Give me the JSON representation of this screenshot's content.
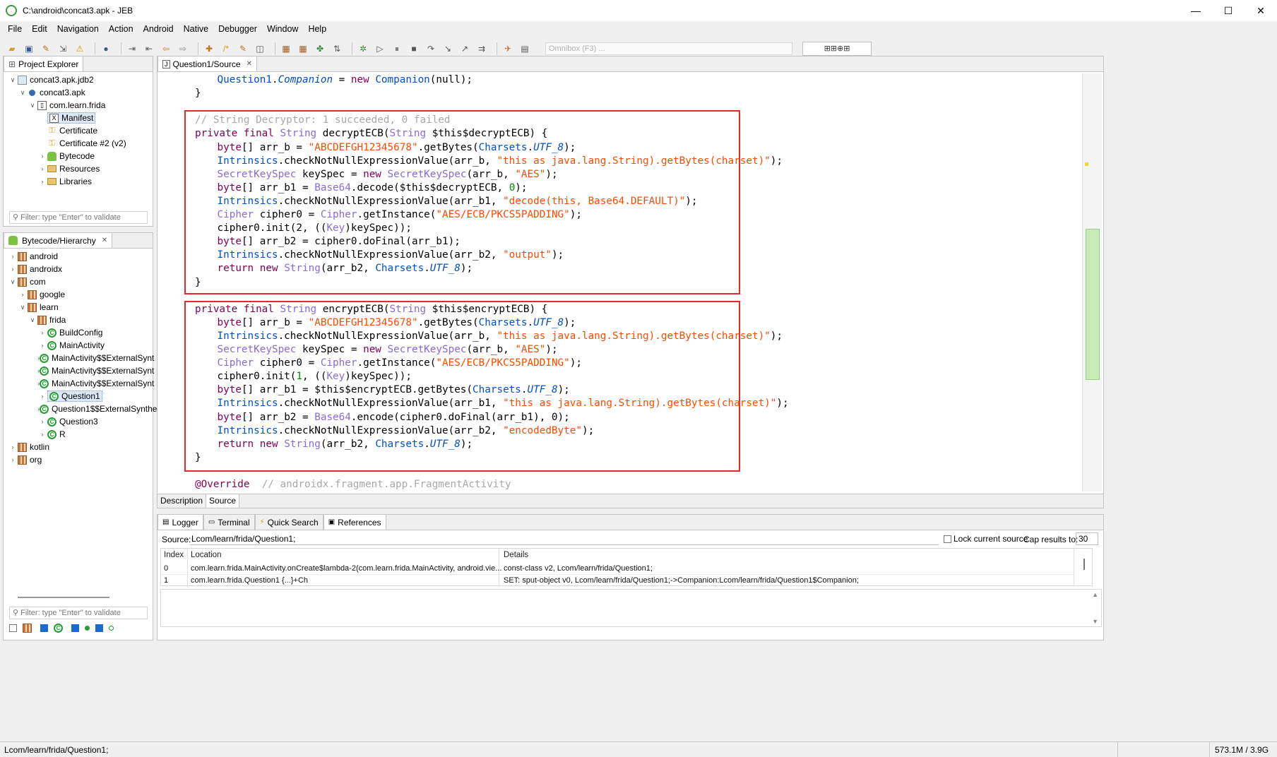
{
  "window": {
    "title": "C:\\android\\concat3.apk - JEB",
    "controls": {
      "minimize": "—",
      "maximize": "☐",
      "close": "✕"
    }
  },
  "menu": [
    "File",
    "Edit",
    "Navigation",
    "Action",
    "Android",
    "Native",
    "Debugger",
    "Window",
    "Help"
  ],
  "toolbar": {
    "omnibox_placeholder": "Omnibox (F3) ...",
    "extra_button": "⊞⊞⊕⊞"
  },
  "project_explorer": {
    "tab_label": "Project Explorer",
    "filter_placeholder": "Filter: type \"Enter\" to validate",
    "items": [
      {
        "label": "concat3.apk.jdb2",
        "level": 0,
        "expanded": true,
        "icon": "jdb-icon"
      },
      {
        "label": "concat3.apk",
        "level": 1,
        "expanded": true,
        "icon": "apk-icon"
      },
      {
        "label": "com.learn.frida",
        "level": 2,
        "expanded": true,
        "icon": "package-icon"
      },
      {
        "label": "Manifest",
        "level": 3,
        "icon": "manifest-icon",
        "selected": true
      },
      {
        "label": "Certificate",
        "level": 3,
        "icon": "key-icon"
      },
      {
        "label": "Certificate #2 (v2)",
        "level": 3,
        "icon": "key-icon"
      },
      {
        "label": "Bytecode",
        "level": 3,
        "expandable": true,
        "icon": "android-icon"
      },
      {
        "label": "Resources",
        "level": 3,
        "expandable": true,
        "icon": "folder-icon"
      },
      {
        "label": "Libraries",
        "level": 3,
        "expandable": true,
        "icon": "folder-icon"
      }
    ]
  },
  "hierarchy": {
    "tab_label": "Bytecode/Hierarchy",
    "filter_placeholder": "Filter: type \"Enter\" to validate",
    "items": [
      {
        "label": "android",
        "level": 0,
        "expandable": true,
        "icon": "pkg"
      },
      {
        "label": "androidx",
        "level": 0,
        "expandable": true,
        "icon": "pkg"
      },
      {
        "label": "com",
        "level": 0,
        "expanded": true,
        "icon": "pkg"
      },
      {
        "label": "google",
        "level": 1,
        "expandable": true,
        "icon": "pkg"
      },
      {
        "label": "learn",
        "level": 1,
        "expanded": true,
        "icon": "pkg"
      },
      {
        "label": "frida",
        "level": 2,
        "expanded": true,
        "icon": "pkg"
      },
      {
        "label": "BuildConfig",
        "level": 3,
        "expandable": true,
        "icon": "class"
      },
      {
        "label": "MainActivity",
        "level": 3,
        "expandable": true,
        "icon": "class"
      },
      {
        "label": "MainActivity$$ExternalSynt",
        "level": 3,
        "expandable": true,
        "icon": "class"
      },
      {
        "label": "MainActivity$$ExternalSynt",
        "level": 3,
        "expandable": true,
        "icon": "class"
      },
      {
        "label": "MainActivity$$ExternalSynt",
        "level": 3,
        "expandable": true,
        "icon": "class"
      },
      {
        "label": "Question1",
        "level": 3,
        "expandable": true,
        "icon": "class",
        "selected": true
      },
      {
        "label": "Question1$$ExternalSynthe",
        "level": 3,
        "expandable": true,
        "icon": "class"
      },
      {
        "label": "Question3",
        "level": 3,
        "expandable": true,
        "icon": "class"
      },
      {
        "label": "R",
        "level": 3,
        "expandable": true,
        "icon": "class"
      },
      {
        "label": "kotlin",
        "level": 0,
        "expandable": true,
        "icon": "pkg"
      },
      {
        "label": "org",
        "level": 0,
        "expandable": true,
        "icon": "pkg"
      }
    ]
  },
  "editor": {
    "tab_label": "Question1/Source",
    "bottom_tabs": [
      "Description",
      "Source"
    ]
  },
  "code_lines": [
    {
      "i": 1,
      "t": [
        [
          "cls",
          "Question1"
        ],
        [
          "",
          "."
        ],
        [
          "itl",
          "Companion"
        ],
        [
          "",
          " = "
        ],
        [
          "kw",
          "new"
        ],
        [
          "",
          " "
        ],
        [
          "cls",
          "Companion"
        ],
        [
          "",
          "(null);"
        ]
      ]
    },
    {
      "i": 0,
      "t": [
        [
          "",
          "}"
        ]
      ]
    },
    {
      "i": 0,
      "t": []
    },
    {
      "i": 0,
      "t": [
        [
          "cmt",
          "// String Decryptor: 1 succeeded, 0 failed"
        ]
      ]
    },
    {
      "i": 0,
      "t": [
        [
          "kw",
          "private final "
        ],
        [
          "lib",
          "String"
        ],
        [
          "",
          " decryptECB("
        ],
        [
          "lib",
          "String"
        ],
        [
          "",
          " $this$decryptECB) {"
        ]
      ]
    },
    {
      "i": 1,
      "t": [
        [
          "kw",
          "byte"
        ],
        [
          "",
          "[] arr_b = "
        ],
        [
          "str",
          "\"ABCDEFGH12345678\""
        ],
        [
          "",
          ".getBytes("
        ],
        [
          "cls",
          "Charsets"
        ],
        [
          "",
          "."
        ],
        [
          "itl",
          "UTF_8"
        ],
        [
          "",
          ");"
        ]
      ]
    },
    {
      "i": 1,
      "t": [
        [
          "cls",
          "Intrinsics"
        ],
        [
          "",
          ".checkNotNullExpressionValue(arr_b, "
        ],
        [
          "str",
          "\"this as java.lang.String).getBytes(charset)\""
        ],
        [
          "",
          ");"
        ]
      ]
    },
    {
      "i": 1,
      "t": [
        [
          "lib",
          "SecretKeySpec"
        ],
        [
          "",
          " keySpec = "
        ],
        [
          "kw",
          "new"
        ],
        [
          "",
          " "
        ],
        [
          "lib",
          "SecretKeySpec"
        ],
        [
          "",
          "(arr_b, "
        ],
        [
          "str",
          "\"AES\""
        ],
        [
          "",
          ");"
        ]
      ]
    },
    {
      "i": 1,
      "t": [
        [
          "kw",
          "byte"
        ],
        [
          "",
          "[] arr_b1 = "
        ],
        [
          "lib",
          "Base64"
        ],
        [
          "",
          ".decode($this$decryptECB, "
        ],
        [
          "num",
          "0"
        ],
        [
          "",
          ");"
        ]
      ]
    },
    {
      "i": 1,
      "t": [
        [
          "cls",
          "Intrinsics"
        ],
        [
          "",
          ".checkNotNullExpressionValue(arr_b1, "
        ],
        [
          "str",
          "\"decode(this, Base64.DEFAULT)\""
        ],
        [
          "",
          ");"
        ]
      ]
    },
    {
      "i": 1,
      "t": [
        [
          "lib",
          "Cipher"
        ],
        [
          "",
          " cipher0 = "
        ],
        [
          "lib",
          "Cipher"
        ],
        [
          "",
          ".getInstance("
        ],
        [
          "str",
          "\"AES/ECB/PKCS5PADDING\""
        ],
        [
          "",
          ");"
        ]
      ]
    },
    {
      "i": 1,
      "t": [
        [
          "",
          "cipher0.init(2, (("
        ],
        [
          "lib",
          "Key"
        ],
        [
          "",
          ")keySpec));"
        ]
      ]
    },
    {
      "i": 1,
      "t": [
        [
          "kw",
          "byte"
        ],
        [
          "",
          "[] arr_b2 = cipher0.doFinal(arr_b1);"
        ]
      ]
    },
    {
      "i": 1,
      "t": [
        [
          "cls",
          "Intrinsics"
        ],
        [
          "",
          ".checkNotNullExpressionValue(arr_b2, "
        ],
        [
          "str",
          "\"output\""
        ],
        [
          "",
          ");"
        ]
      ]
    },
    {
      "i": 1,
      "t": [
        [
          "kw",
          "return new "
        ],
        [
          "lib",
          "String"
        ],
        [
          "",
          "(arr_b2, "
        ],
        [
          "cls",
          "Charsets"
        ],
        [
          "",
          "."
        ],
        [
          "itl",
          "UTF_8"
        ],
        [
          "",
          ");"
        ]
      ]
    },
    {
      "i": 0,
      "t": [
        [
          "",
          "}"
        ]
      ]
    },
    {
      "i": 0,
      "t": []
    },
    {
      "i": 0,
      "t": [
        [
          "kw",
          "private final "
        ],
        [
          "lib",
          "String"
        ],
        [
          "",
          " encryptECB("
        ],
        [
          "lib",
          "String"
        ],
        [
          "",
          " $this$encryptECB) {"
        ]
      ]
    },
    {
      "i": 1,
      "t": [
        [
          "kw",
          "byte"
        ],
        [
          "",
          "[] arr_b = "
        ],
        [
          "str",
          "\"ABCDEFGH12345678\""
        ],
        [
          "",
          ".getBytes("
        ],
        [
          "cls",
          "Charsets"
        ],
        [
          "",
          "."
        ],
        [
          "itl",
          "UTF_8"
        ],
        [
          "",
          ");"
        ]
      ]
    },
    {
      "i": 1,
      "t": [
        [
          "cls",
          "Intrinsics"
        ],
        [
          "",
          ".checkNotNullExpressionValue(arr_b, "
        ],
        [
          "str",
          "\"this as java.lang.String).getBytes(charset)\""
        ],
        [
          "",
          ");"
        ]
      ]
    },
    {
      "i": 1,
      "t": [
        [
          "lib",
          "SecretKeySpec"
        ],
        [
          "",
          " keySpec = "
        ],
        [
          "kw",
          "new"
        ],
        [
          "",
          " "
        ],
        [
          "lib",
          "SecretKeySpec"
        ],
        [
          "",
          "(arr_b, "
        ],
        [
          "str",
          "\"AES\""
        ],
        [
          "",
          ");"
        ]
      ]
    },
    {
      "i": 1,
      "t": [
        [
          "lib",
          "Cipher"
        ],
        [
          "",
          " cipher0 = "
        ],
        [
          "lib",
          "Cipher"
        ],
        [
          "",
          ".getInstance("
        ],
        [
          "str",
          "\"AES/ECB/PKCS5PADDING\""
        ],
        [
          "",
          ");"
        ]
      ]
    },
    {
      "i": 1,
      "t": [
        [
          "",
          "cipher0.init("
        ],
        [
          "num",
          "1"
        ],
        [
          "",
          ", (("
        ],
        [
          "lib",
          "Key"
        ],
        [
          "",
          ")keySpec));"
        ]
      ]
    },
    {
      "i": 1,
      "t": [
        [
          "kw",
          "byte"
        ],
        [
          "",
          "[] arr_b1 = $this$encryptECB.getBytes("
        ],
        [
          "cls",
          "Charsets"
        ],
        [
          "",
          "."
        ],
        [
          "itl",
          "UTF_8"
        ],
        [
          "",
          ");"
        ]
      ]
    },
    {
      "i": 1,
      "t": [
        [
          "cls",
          "Intrinsics"
        ],
        [
          "",
          ".checkNotNullExpressionValue(arr_b1, "
        ],
        [
          "str",
          "\"this as java.lang.String).getBytes(charset)\""
        ],
        [
          "",
          ");"
        ]
      ]
    },
    {
      "i": 1,
      "t": [
        [
          "kw",
          "byte"
        ],
        [
          "",
          "[] arr_b2 = "
        ],
        [
          "lib",
          "Base64"
        ],
        [
          "",
          ".encode(cipher0.doFinal(arr_b1), 0);"
        ]
      ]
    },
    {
      "i": 1,
      "t": [
        [
          "cls",
          "Intrinsics"
        ],
        [
          "",
          ".checkNotNullExpressionValue(arr_b2, "
        ],
        [
          "str",
          "\"encodedByte\""
        ],
        [
          "",
          ");"
        ]
      ]
    },
    {
      "i": 1,
      "t": [
        [
          "kw",
          "return new "
        ],
        [
          "lib",
          "String"
        ],
        [
          "",
          "(arr_b2, "
        ],
        [
          "cls",
          "Charsets"
        ],
        [
          "",
          "."
        ],
        [
          "itl",
          "UTF_8"
        ],
        [
          "",
          ");"
        ]
      ]
    },
    {
      "i": 0,
      "t": [
        [
          "",
          "}"
        ]
      ]
    },
    {
      "i": 0,
      "t": []
    },
    {
      "i": 0,
      "t": [
        [
          "kw",
          "@Override"
        ],
        [
          "",
          "  "
        ],
        [
          "cmt",
          "// androidx.fragment.app.FragmentActivity"
        ]
      ]
    }
  ],
  "bottom_panel": {
    "tabs": [
      "Logger",
      "Terminal",
      "Quick Search",
      "References"
    ],
    "source_label": "Source:",
    "source_value": "Lcom/learn/frida/Question1;",
    "lock_label": "Lock current source",
    "cap_label": "Cap results to:",
    "cap_value": "30",
    "columns": [
      "Index",
      "Location",
      "Details"
    ],
    "rows": [
      {
        "index": "0",
        "location": "com.learn.frida.MainActivity.onCreate$lambda-2(com.learn.frida.MainActivity, android.vie...",
        "details": "const-class v2, Lcom/learn/frida/Question1;"
      },
      {
        "index": "1",
        "location": "com.learn.frida.Question1 {...}+Ch",
        "details": "SET: sput-object v0, Lcom/learn/frida/Question1;->Companion:Lcom/learn/frida/Question1$Companion;"
      }
    ]
  },
  "status": {
    "left": "Lcom/learn/frida/Question1;",
    "memory": "573.1M / 3.9G"
  }
}
